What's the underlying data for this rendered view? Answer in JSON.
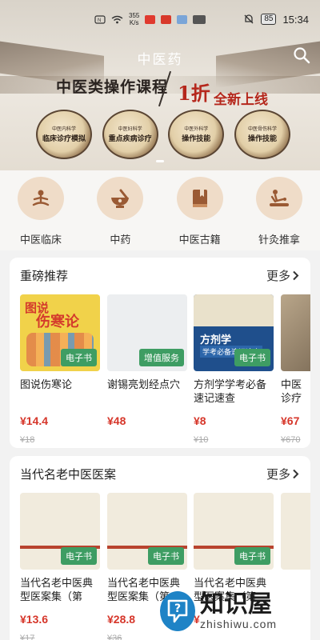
{
  "status_bar": {
    "speed": "355\nK/s",
    "speed_line1": "355",
    "speed_line2": "K/s",
    "battery": "85",
    "time": "15:34"
  },
  "hero": {
    "title": "中医药",
    "headline": "中医类操作课程",
    "discount": "1折",
    "new_label": "全新上线",
    "coins": [
      {
        "small": "中医内科学",
        "big": "临床诊疗模拟"
      },
      {
        "small": "中医妇科学",
        "big": "重点疾病诊疗"
      },
      {
        "small": "中医外科学",
        "big": "操作技能"
      },
      {
        "small": "中医骨伤科学",
        "big": "操作技能"
      }
    ]
  },
  "categories": [
    {
      "label": "中医临床",
      "icon": "meditation-icon"
    },
    {
      "label": "中药",
      "icon": "mortar-icon"
    },
    {
      "label": "中医古籍",
      "icon": "book-icon"
    },
    {
      "label": "针灸推拿",
      "icon": "massage-icon"
    }
  ],
  "section_featured": {
    "title": "重磅推荐",
    "more": "更多",
    "books": [
      {
        "cover_title_1": "图说",
        "cover_title_2": "伤寒论",
        "badge": "电子书",
        "title": "图说伤寒论",
        "price": "¥14.4",
        "original": "¥18"
      },
      {
        "badge": "增值服务",
        "title": "谢锡亮划经点穴",
        "price": "¥48",
        "original": ""
      },
      {
        "cover_title": "方剂学",
        "cover_sub": "学考必备速记速查",
        "badge": "电子书",
        "title": "方剂学学考必备速记速查",
        "price": "¥8",
        "original": "¥10"
      },
      {
        "badge": "",
        "title": "中医诊疗",
        "price": "¥67",
        "original": "¥670"
      }
    ]
  },
  "section_cases": {
    "title": "当代名老中医医案",
    "more": "更多",
    "books": [
      {
        "badge": "电子书",
        "title": "当代名老中医典型医案集（第",
        "price": "¥13.6",
        "original": "¥17"
      },
      {
        "badge": "电子书",
        "title": "当代名老中医典型医案集（第",
        "price": "¥28.8",
        "original": "¥36"
      },
      {
        "badge": "电子书",
        "title": "当代名老中医典型医案集（第",
        "price": "¥",
        "original": ""
      },
      {
        "badge": "",
        "title": "",
        "price": "",
        "original": ""
      }
    ]
  },
  "watermark": {
    "cn": "知识屋",
    "en": "zhishiwu.com"
  },
  "colors": {
    "accent_red": "#d6362a",
    "badge_green": "#3e9d63",
    "category_bg": "#efdcc8"
  }
}
